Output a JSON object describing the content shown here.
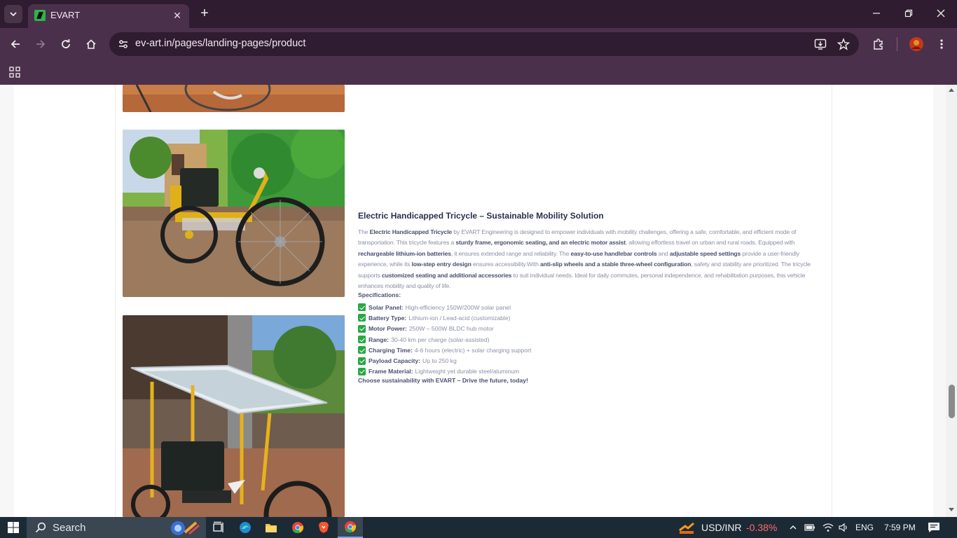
{
  "browser": {
    "tab_title": "EVART",
    "url": "ev-art.in/pages/landing-pages/product"
  },
  "product": {
    "title": "Electric Handicapped Tricycle – Sustainable Mobility Solution",
    "specs_heading": "Specifications:",
    "specs": [
      {
        "key": "Solar Panel:",
        "value": "High-efficiency 150W/200W solar panel"
      },
      {
        "key": "Battery Type:",
        "value": "Lithium-ion / Lead-acid (customizable)"
      },
      {
        "key": "Motor Power:",
        "value": "250W – 500W BLDC hub motor"
      },
      {
        "key": "Range:",
        "value": "30-40 km per charge (solar-assisted)"
      },
      {
        "key": "Charging Time:",
        "value": "4-6 hours (electric) + solar charging support"
      },
      {
        "key": "Payload Capacity:",
        "value": "Up to 250 kg"
      },
      {
        "key": "Frame Material:",
        "value": "Lightweight yet durable steel/aluminum"
      }
    ],
    "tagline": "Choose sustainability with EVART – Drive the future, today!",
    "desc": {
      "p1": "The ",
      "b1": "Electric Handicapped Tricycle",
      "p2": " by EVART Engineering is designed to empower individuals with mobility challenges, offering a safe, comfortable, and efficient mode of transportation. This tricycle features a ",
      "b2": "sturdy frame, ergonomic seating, and an electric motor assist",
      "p3": ", allowing effortless travel on urban and rural roads. Equipped with ",
      "b3": "rechargeable lithium-ion batteries",
      "p4": ", it ensures extended range and reliability. The ",
      "b4": "easy-to-use handlebar controls",
      "p5": " and ",
      "b5": "adjustable speed settings",
      "p6": " provide a user-friendly experience, while its ",
      "b6": "low-step entry design",
      "p7": " ensures accessibility.With ",
      "b7": "anti-slip wheels and a stable three-wheel configuration",
      "p8": ", safety and stability are prioritized. The tricycle supports ",
      "b8": "customized seating and additional accessories",
      "p9": " to suit individual needs. Ideal for daily commutes, personal independence, and rehabilitation purposes, this vehicle enhances mobility and quality of life."
    }
  },
  "taskbar": {
    "search_placeholder": "Search",
    "ticker_label": "USD/INR",
    "ticker_change": "-0.38%",
    "language": "ENG",
    "time": "7:59 PM"
  },
  "colors": {
    "chrome_dark": "#301c30",
    "chrome": "#4b304b",
    "accent_check": "#27a844",
    "heading": "#2a3050",
    "body_text": "#8a8ea8"
  }
}
